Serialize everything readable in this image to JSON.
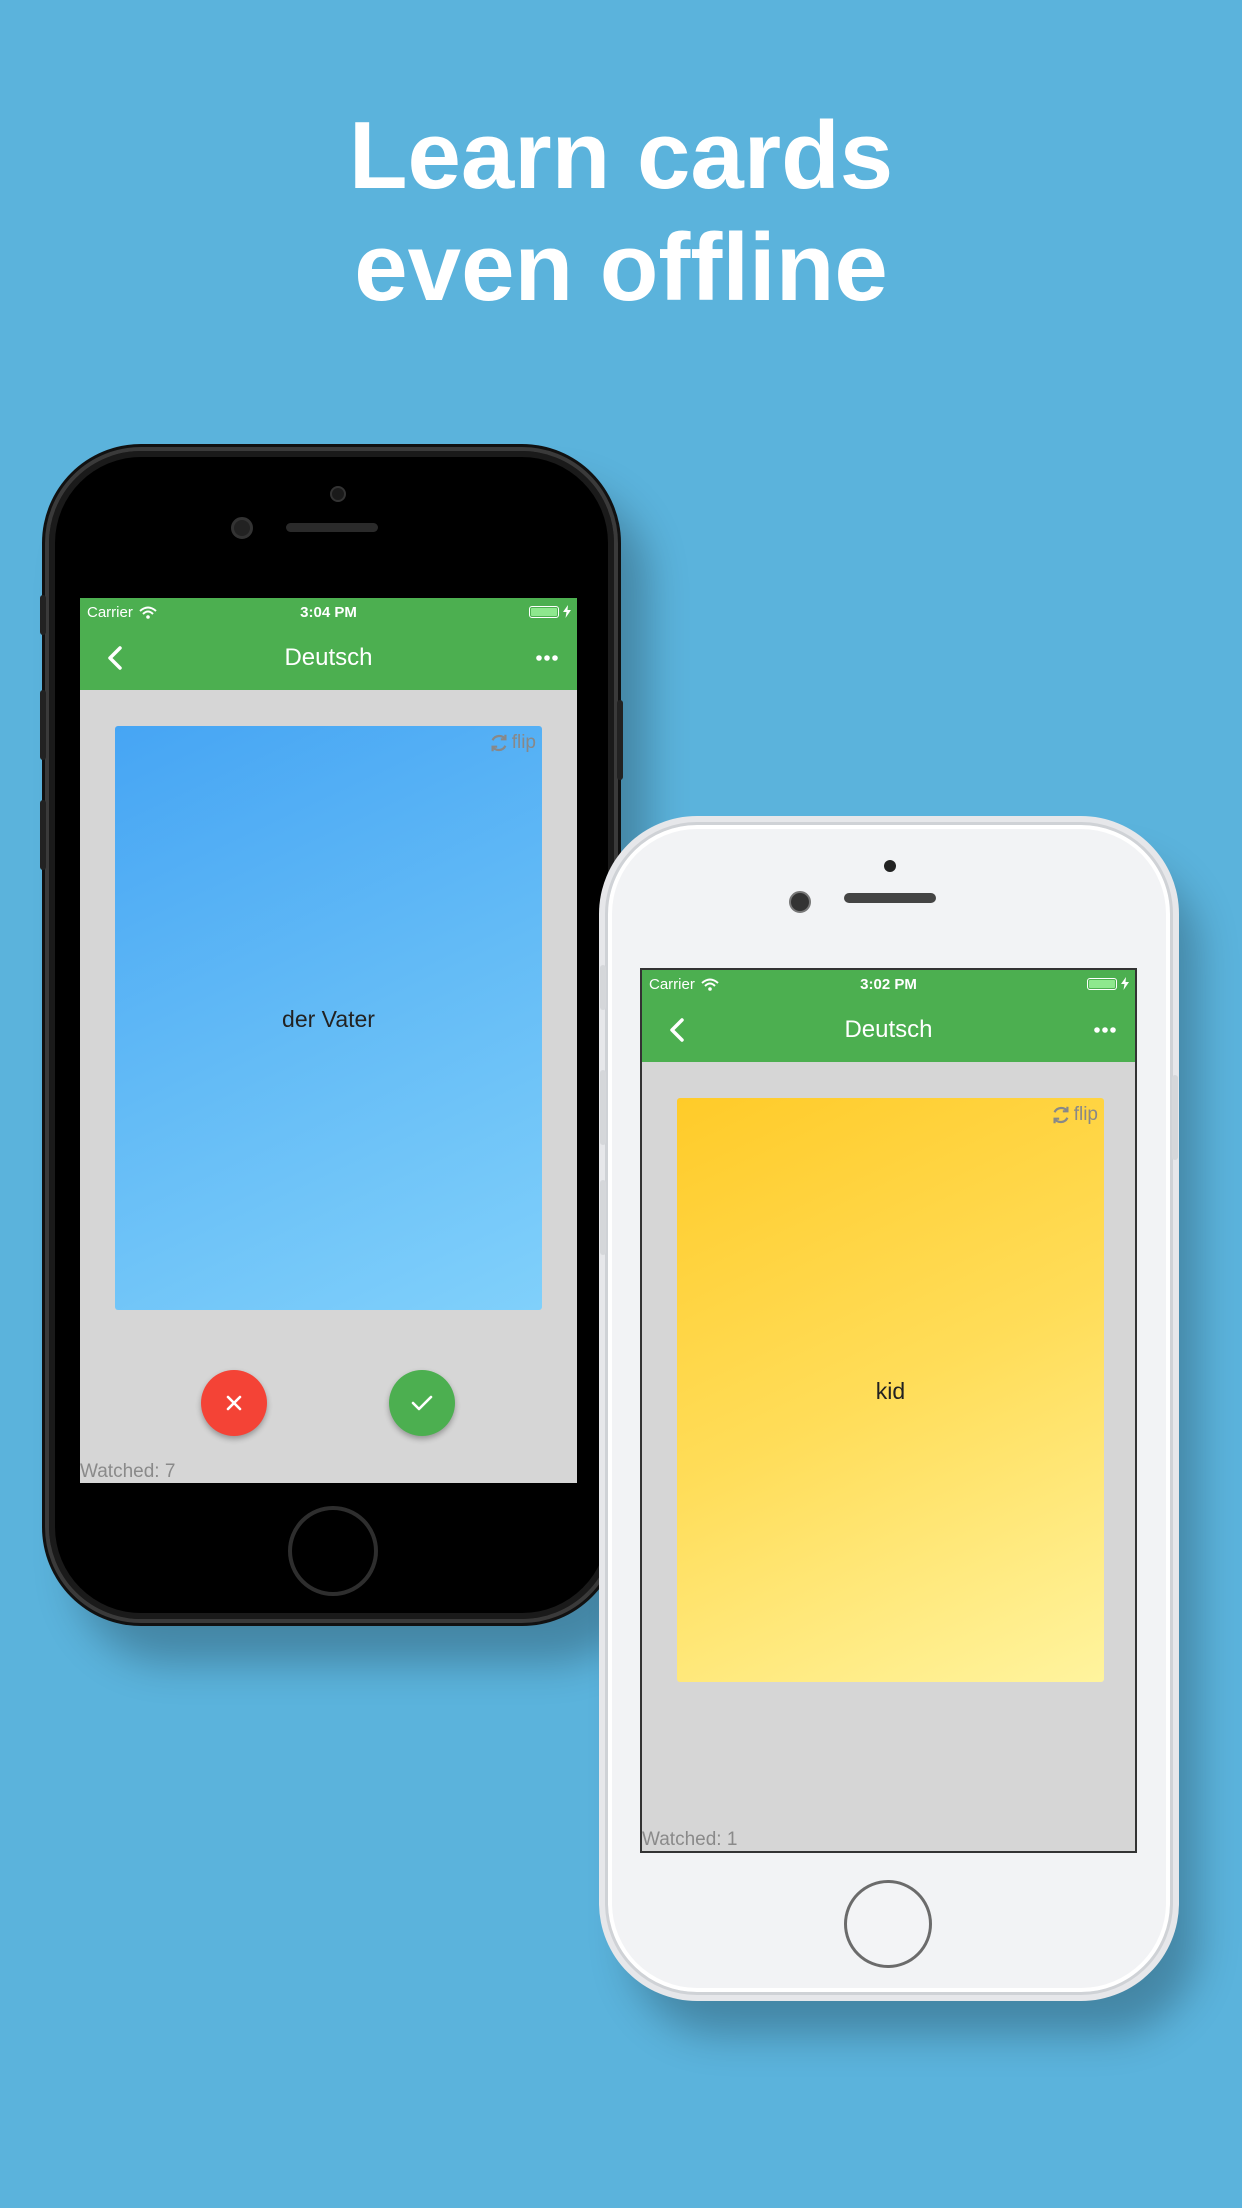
{
  "headline": {
    "line1": "Learn cards",
    "line2": "even offline"
  },
  "phones": [
    {
      "status": {
        "carrier": "Carrier",
        "time": "3:04 PM"
      },
      "appbar": {
        "title": "Deutsch"
      },
      "card": {
        "text": "der Vater",
        "flip_label": "flip",
        "color": "#46a5f4"
      },
      "watched": "Watched: 7"
    },
    {
      "status": {
        "carrier": "Carrier",
        "time": "3:02 PM"
      },
      "appbar": {
        "title": "Deutsch"
      },
      "card": {
        "text": "kid",
        "flip_label": "flip",
        "color": "#ffcb29"
      },
      "watched": "Watched: 1"
    }
  ],
  "colors": {
    "background": "#5bb3dc",
    "appbar": "#4caf50",
    "reject": "#f44336",
    "accept": "#4caf50"
  },
  "icons": [
    "back-arrow-icon",
    "more-dots-icon",
    "wifi-icon",
    "battery-icon",
    "refresh-icon",
    "close-icon",
    "check-icon"
  ]
}
